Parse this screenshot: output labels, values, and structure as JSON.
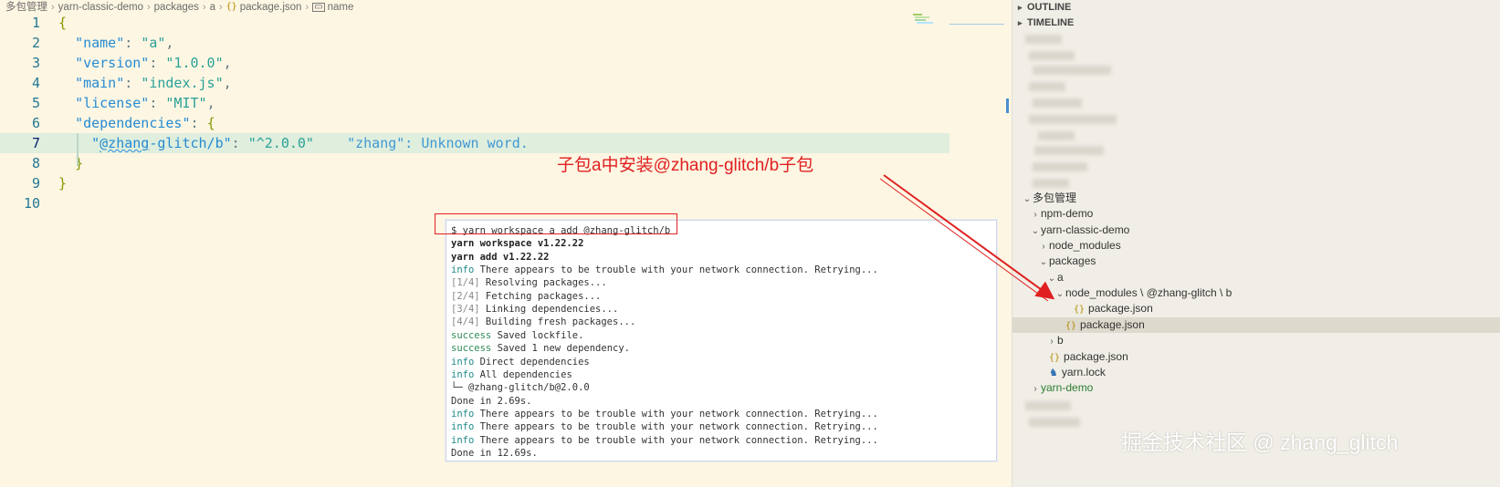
{
  "breadcrumb": [
    "多包管理",
    "yarn-classic-demo",
    "packages",
    "a",
    "package.json",
    "name"
  ],
  "editor": {
    "line_numbers": [
      "1",
      "2",
      "3",
      "4",
      "5",
      "6",
      "7",
      "8",
      "9",
      "10"
    ],
    "lines": {
      "l1_brace": "{",
      "l2_key": "\"name\"",
      "l2_val": "\"a\"",
      "l3_key": "\"version\"",
      "l3_val": "\"1.0.0\"",
      "l4_key": "\"main\"",
      "l4_val": "\"index.js\"",
      "l5_key": "\"license\"",
      "l5_val": "\"MIT\"",
      "l6_key": "\"dependencies\"",
      "l6_brace": "{",
      "l7_q": "\"",
      "l7_key_word": "@zhang",
      "l7_key_rest": "-glitch/b\"",
      "l7_val": "\"^2.0.0\"",
      "l7_diag": "\"zhang\": Unknown word.",
      "l8_brace": "}",
      "l9_brace": "}"
    },
    "colon": ": ",
    "comma": ","
  },
  "sidebar": {
    "headers": [
      "OUTLINE",
      "TIMELINE"
    ],
    "tree": [
      {
        "label": "多包管理",
        "level": 0,
        "twist": "open"
      },
      {
        "label": "npm-demo",
        "level": 1,
        "twist": "closed"
      },
      {
        "label": "yarn-classic-demo",
        "level": 1,
        "twist": "open"
      },
      {
        "label": "node_modules",
        "level": 2,
        "twist": "closed"
      },
      {
        "label": "packages",
        "level": 2,
        "twist": "open"
      },
      {
        "label": "a",
        "level": 3,
        "twist": "open"
      },
      {
        "label": "node_modules \\ @zhang-glitch \\ b",
        "level": 4,
        "twist": "open"
      },
      {
        "label": "package.json",
        "level": 5,
        "icon": "json"
      },
      {
        "label": "package.json",
        "level": 4,
        "icon": "json",
        "selected": true
      },
      {
        "label": "b",
        "level": 3,
        "twist": "closed"
      },
      {
        "label": "package.json",
        "level": 2,
        "icon": "json"
      },
      {
        "label": "yarn.lock",
        "level": 2,
        "icon": "lock"
      },
      {
        "label": "yarn-demo",
        "level": 1,
        "twist": "closed",
        "green": true
      }
    ]
  },
  "terminal": {
    "lines": [
      {
        "text": "$ yarn workspace a add @zhang-glitch/b"
      },
      {
        "text": "yarn workspace v1.22.22",
        "bold": true
      },
      {
        "text": "yarn add v1.22.22",
        "bold": true
      },
      {
        "prefix": "info",
        "ptype": "info",
        "text": " There appears to be trouble with your network connection. Retrying..."
      },
      {
        "prefix": "[1/4]",
        "ptype": "step",
        "text": " Resolving packages..."
      },
      {
        "prefix": "[2/4]",
        "ptype": "step",
        "text": " Fetching packages..."
      },
      {
        "prefix": "[3/4]",
        "ptype": "step",
        "text": " Linking dependencies..."
      },
      {
        "prefix": "[4/4]",
        "ptype": "step",
        "text": " Building fresh packages..."
      },
      {
        "prefix": "success",
        "ptype": "success",
        "text": " Saved lockfile."
      },
      {
        "prefix": "success",
        "ptype": "success",
        "text": " Saved 1 new dependency."
      },
      {
        "prefix": "info",
        "ptype": "info",
        "text": " Direct dependencies"
      },
      {
        "prefix": "info",
        "ptype": "info",
        "text": " All dependencies"
      },
      {
        "text": "└─ @zhang-glitch/b@2.0.0"
      },
      {
        "text": "Done in 2.69s."
      },
      {
        "prefix": "info",
        "ptype": "info",
        "text": " There appears to be trouble with your network connection. Retrying..."
      },
      {
        "prefix": "info",
        "ptype": "info",
        "text": " There appears to be trouble with your network connection. Retrying..."
      },
      {
        "prefix": "info",
        "ptype": "info",
        "text": " There appears to be trouble with your network connection. Retrying..."
      },
      {
        "text": "Done in 12.69s."
      }
    ]
  },
  "annotation": "子包a中安装@zhang-glitch/b子包",
  "watermark": "掘金技术社区 @ zhang_glitch",
  "colors": {
    "editor_bg": "#fdf6e3",
    "highlight_line": "#dfeedd",
    "annotation_red": "#e02020",
    "json_icon": "#b58900",
    "key_blue": "#268bd2",
    "string_teal": "#2aa198"
  },
  "icons": {
    "breadcrumb_file": "json-braces-icon",
    "breadcrumb_symbol": "symbol-field-icon",
    "tree_json": "json-braces-icon",
    "tree_lock": "yarn-lock-icon",
    "twist_open": "chevron-down-icon",
    "twist_closed": "chevron-right-icon"
  }
}
